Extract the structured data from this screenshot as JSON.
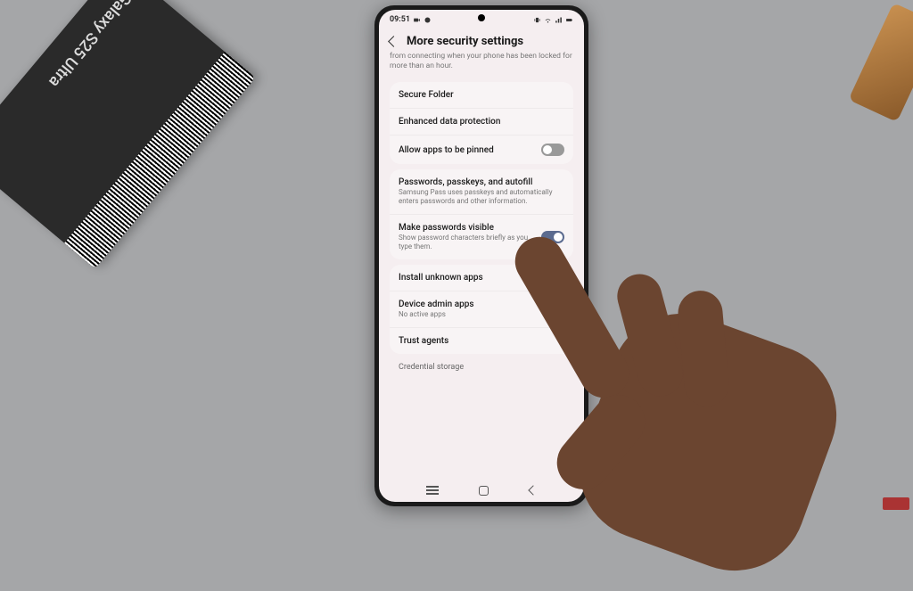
{
  "box": {
    "label": "Galaxy S25 Ultra"
  },
  "status": {
    "time": "09:51"
  },
  "header": {
    "title": "More security settings"
  },
  "truncated": "from connecting when your phone has been locked for more than an hour.",
  "group1": {
    "secure_folder": "Secure Folder",
    "enhanced": "Enhanced data protection",
    "pinned": "Allow apps to be pinned"
  },
  "group2": {
    "passwords_title": "Passwords, passkeys, and autofill",
    "passwords_sub": "Samsung Pass uses passkeys and automatically enters passwords and other information.",
    "visible_title": "Make passwords visible",
    "visible_sub": "Show password characters briefly as you type them."
  },
  "group3": {
    "unknown": "Install unknown apps",
    "admin_title": "Device admin apps",
    "admin_sub": "No active apps",
    "trust": "Trust agents"
  },
  "section_label": "Credential storage",
  "toggles": {
    "pinned": false,
    "visible": true
  }
}
